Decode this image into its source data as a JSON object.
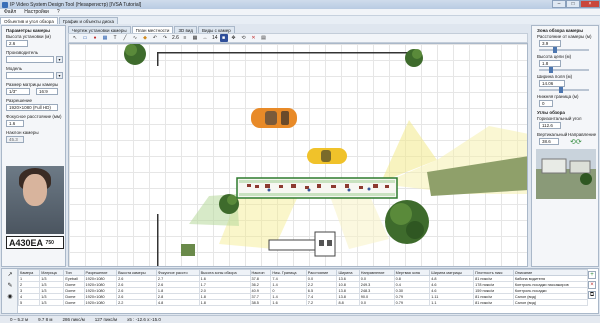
{
  "window": {
    "title": "IP Video System Design Tool (Незарегистр) [IVSA Tutorial]"
  },
  "menu": [
    "Файл",
    "Настройки",
    "?"
  ],
  "main_tabs": [
    "Объектив и угол обзора",
    "График и объекты диска"
  ],
  "left_panel": {
    "section": "Параметры камеры",
    "height_label": "Высота установки (м)",
    "height_value": "2.6",
    "vendor_label": "Производитель",
    "vendor_value": "",
    "model_label": "Модель",
    "model_value": "",
    "sensor_label": "Размер матрицы камеры",
    "sensor_value": "1/3\"",
    "aspect_value": "16:9",
    "resolution_label": "Разрешение",
    "resolution_value": "1920×1080 (Full HD)",
    "focal_label": "Фокусное расстояние (мм)",
    "focal_value": "1.6",
    "tilt_label": "Наклон камеры",
    "tilt_value": "45.3",
    "plate_text": "А430ЕА",
    "plate_region": "750"
  },
  "canvas_tabs": [
    "Чертеж установки камеры",
    "План местности",
    "3D вид",
    "Виды с камер"
  ],
  "toolbar": {
    "zoom": "2.6",
    "width": "14"
  },
  "right_panel": {
    "section": "Зона обзора камеры",
    "dist_label": "Расстояние от камеры (м)",
    "dist_value": "3.9",
    "target_height_label": "Высота цели (м)",
    "target_height_value": "1.8",
    "width_label": "Ширина поля (м)",
    "width_value": "14.06",
    "bottom_label": "Нижняя граница (м)",
    "bottom_value": "0",
    "angles_label": "Углы обзора",
    "hangle_label": "Горизонтальный угол",
    "hangle_value": "112.6",
    "vangle_label": "Вертикальный",
    "vangle_value": "38.6",
    "direction_label": "Направление"
  },
  "table": {
    "headers": [
      "Камера",
      "Матрица",
      "Тип",
      "Разрешение",
      "Высота камеры",
      "Фокусное рассто",
      "Высота зоны обзора",
      "Наклон",
      "Ниж. Граница",
      "Расстояние",
      "Ширина",
      "Направление",
      "Мертвая зона",
      "Ширина матрицы",
      "Плотность пикс",
      "Описание"
    ],
    "rows": [
      [
        "1",
        "1/3",
        "Eyeball",
        "1920×1080",
        "2.6",
        "2.7",
        "1.6",
        "37.8",
        "7.4",
        "0.0",
        "13.6",
        "0.0",
        "0.8",
        "4.8",
        "81 пикс/м",
        "Кабина водителя"
      ],
      [
        "2",
        "1/3",
        "Dome",
        "1920×1080",
        "2.6",
        "2.6",
        "1.7",
        "36.2",
        "1.4",
        "2.2",
        "10.8",
        "249.3",
        "0.4",
        "4.6",
        "178 пикс/м",
        "Контроль посадки пассажиров"
      ],
      [
        "3",
        "1/3",
        "Dome",
        "1920×1080",
        "2.6",
        "1.8",
        "2.0",
        "40.9",
        "0",
        "6.5",
        "13.8",
        "248.3",
        "0.30",
        "4.6",
        "159 пикс/м",
        "Контроль посадки"
      ],
      [
        "4",
        "1/3",
        "Dome",
        "1920×1080",
        "2.6",
        "2.8",
        "1.8",
        "37.7",
        "1.4",
        "7.4",
        "13.8",
        "90.0",
        "0.79",
        "1.11",
        "81 пикс/м",
        "Салон (вид)"
      ],
      [
        "5",
        "1/3",
        "Dome",
        "1920×1080",
        "2.2",
        "4.8",
        "1.8",
        "38.5",
        "1.6",
        "7.2",
        "8.8",
        "0.0",
        "0.79",
        "1.1",
        "81 пикс/м",
        "Салон (вид)"
      ]
    ]
  },
  "status": [
    "0 – 5.2 м",
    "9.7 8 м",
    "286 пикс/м",
    "127 пикс/м",
    "x5 : -12.6 x:-15.0"
  ],
  "colors": {
    "accent": "#4c76b0",
    "fov_yellow": "#f3ea8a",
    "fov_green": "#b7d89a",
    "bus_green": "#2e7b2e"
  }
}
